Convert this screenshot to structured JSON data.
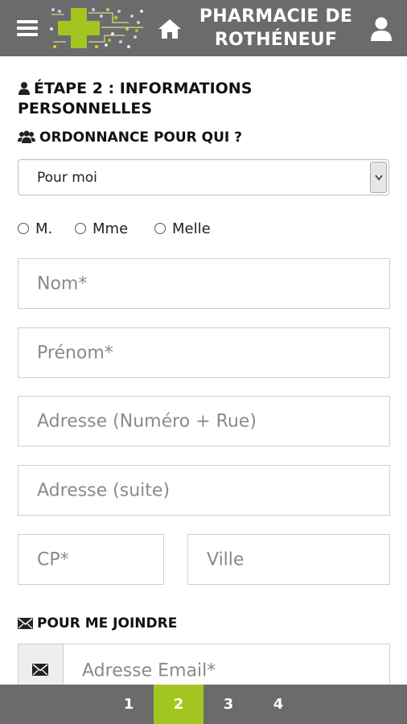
{
  "header": {
    "brand_line1": "PHARMACIE DE",
    "brand_line2": "ROTHÉNEUF"
  },
  "step": {
    "title_line1": "ÉTAPE 2 : INFORMATIONS",
    "title_line2": "PERSONNELLES"
  },
  "prescription": {
    "label": "ORDONNANCE POUR QUI ?",
    "selected": "Pour moi"
  },
  "civility": {
    "options": [
      "M.",
      "Mme",
      "Melle"
    ]
  },
  "form": {
    "nom_placeholder": "Nom*",
    "prenom_placeholder": "Prénom*",
    "adresse_placeholder": "Adresse (Numéro + Rue)",
    "adresse_suite_placeholder": "Adresse (suite)",
    "cp_placeholder": "CP*",
    "ville_placeholder": "Ville"
  },
  "contact": {
    "label": "POUR ME JOINDRE",
    "email_placeholder": "Adresse Email*"
  },
  "pager": {
    "pages": [
      "1",
      "2",
      "3",
      "4"
    ],
    "active": "2"
  },
  "colors": {
    "header_bg": "#6b6b6b",
    "accent_green": "#a3c522"
  }
}
